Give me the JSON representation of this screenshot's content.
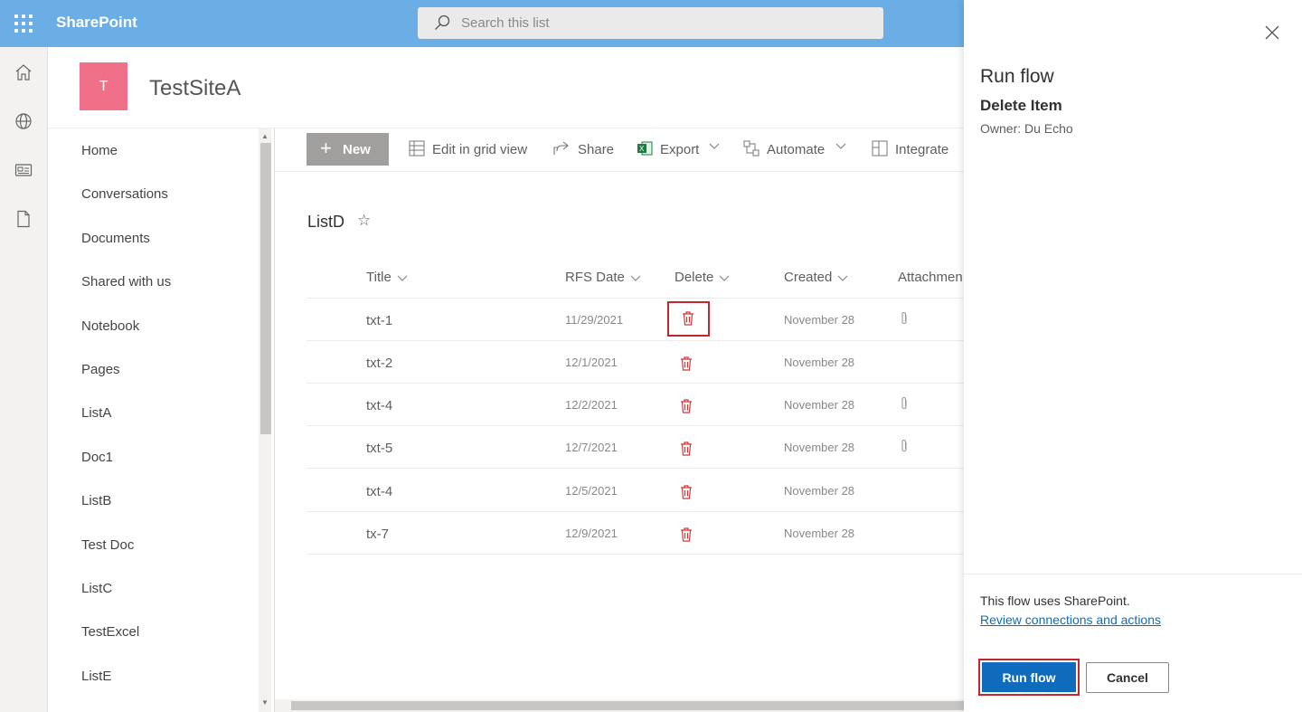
{
  "suite": {
    "brand": "SharePoint",
    "search_placeholder": "Search this list"
  },
  "site": {
    "logo_letter": "T",
    "title": "TestSiteA",
    "logo_color": "#f0708a"
  },
  "leftnav": {
    "items": [
      "Home",
      "Conversations",
      "Documents",
      "Shared with us",
      "Notebook",
      "Pages",
      "ListA",
      "Doc1",
      "ListB",
      "Test Doc",
      "ListC",
      "TestExcel",
      "ListE"
    ]
  },
  "commandbar": {
    "new": "New",
    "edit_grid": "Edit in grid view",
    "share": "Share",
    "export": "Export",
    "automate": "Automate",
    "integrate": "Integrate"
  },
  "list": {
    "title": "ListD",
    "columns": [
      "Title",
      "RFS Date",
      "Delete",
      "Created",
      "Attachmen"
    ],
    "rows": [
      {
        "title": "txt-1",
        "date": "11/29/2021",
        "created": "November 28",
        "attachment": true
      },
      {
        "title": "txt-2",
        "date": "12/1/2021",
        "created": "November 28",
        "attachment": false
      },
      {
        "title": "txt-4",
        "date": "12/2/2021",
        "created": "November 28",
        "attachment": true
      },
      {
        "title": "txt-5",
        "date": "12/7/2021",
        "created": "November 28",
        "attachment": true
      },
      {
        "title": "txt-4",
        "date": "12/5/2021",
        "created": "November 28",
        "attachment": false
      },
      {
        "title": "tx-7",
        "date": "12/9/2021",
        "created": "November 28",
        "attachment": false
      }
    ]
  },
  "panel": {
    "title": "Run flow",
    "flow_name": "Delete Item",
    "owner": "Owner: Du Echo",
    "uses": "This flow uses SharePoint.",
    "link": "Review connections and actions",
    "run": "Run flow",
    "cancel": "Cancel",
    "accent": "#0f6cbd",
    "highlight": "#c4262e"
  },
  "colors": {
    "suite_bar": "#6aaee5",
    "trash": "#d13438"
  }
}
